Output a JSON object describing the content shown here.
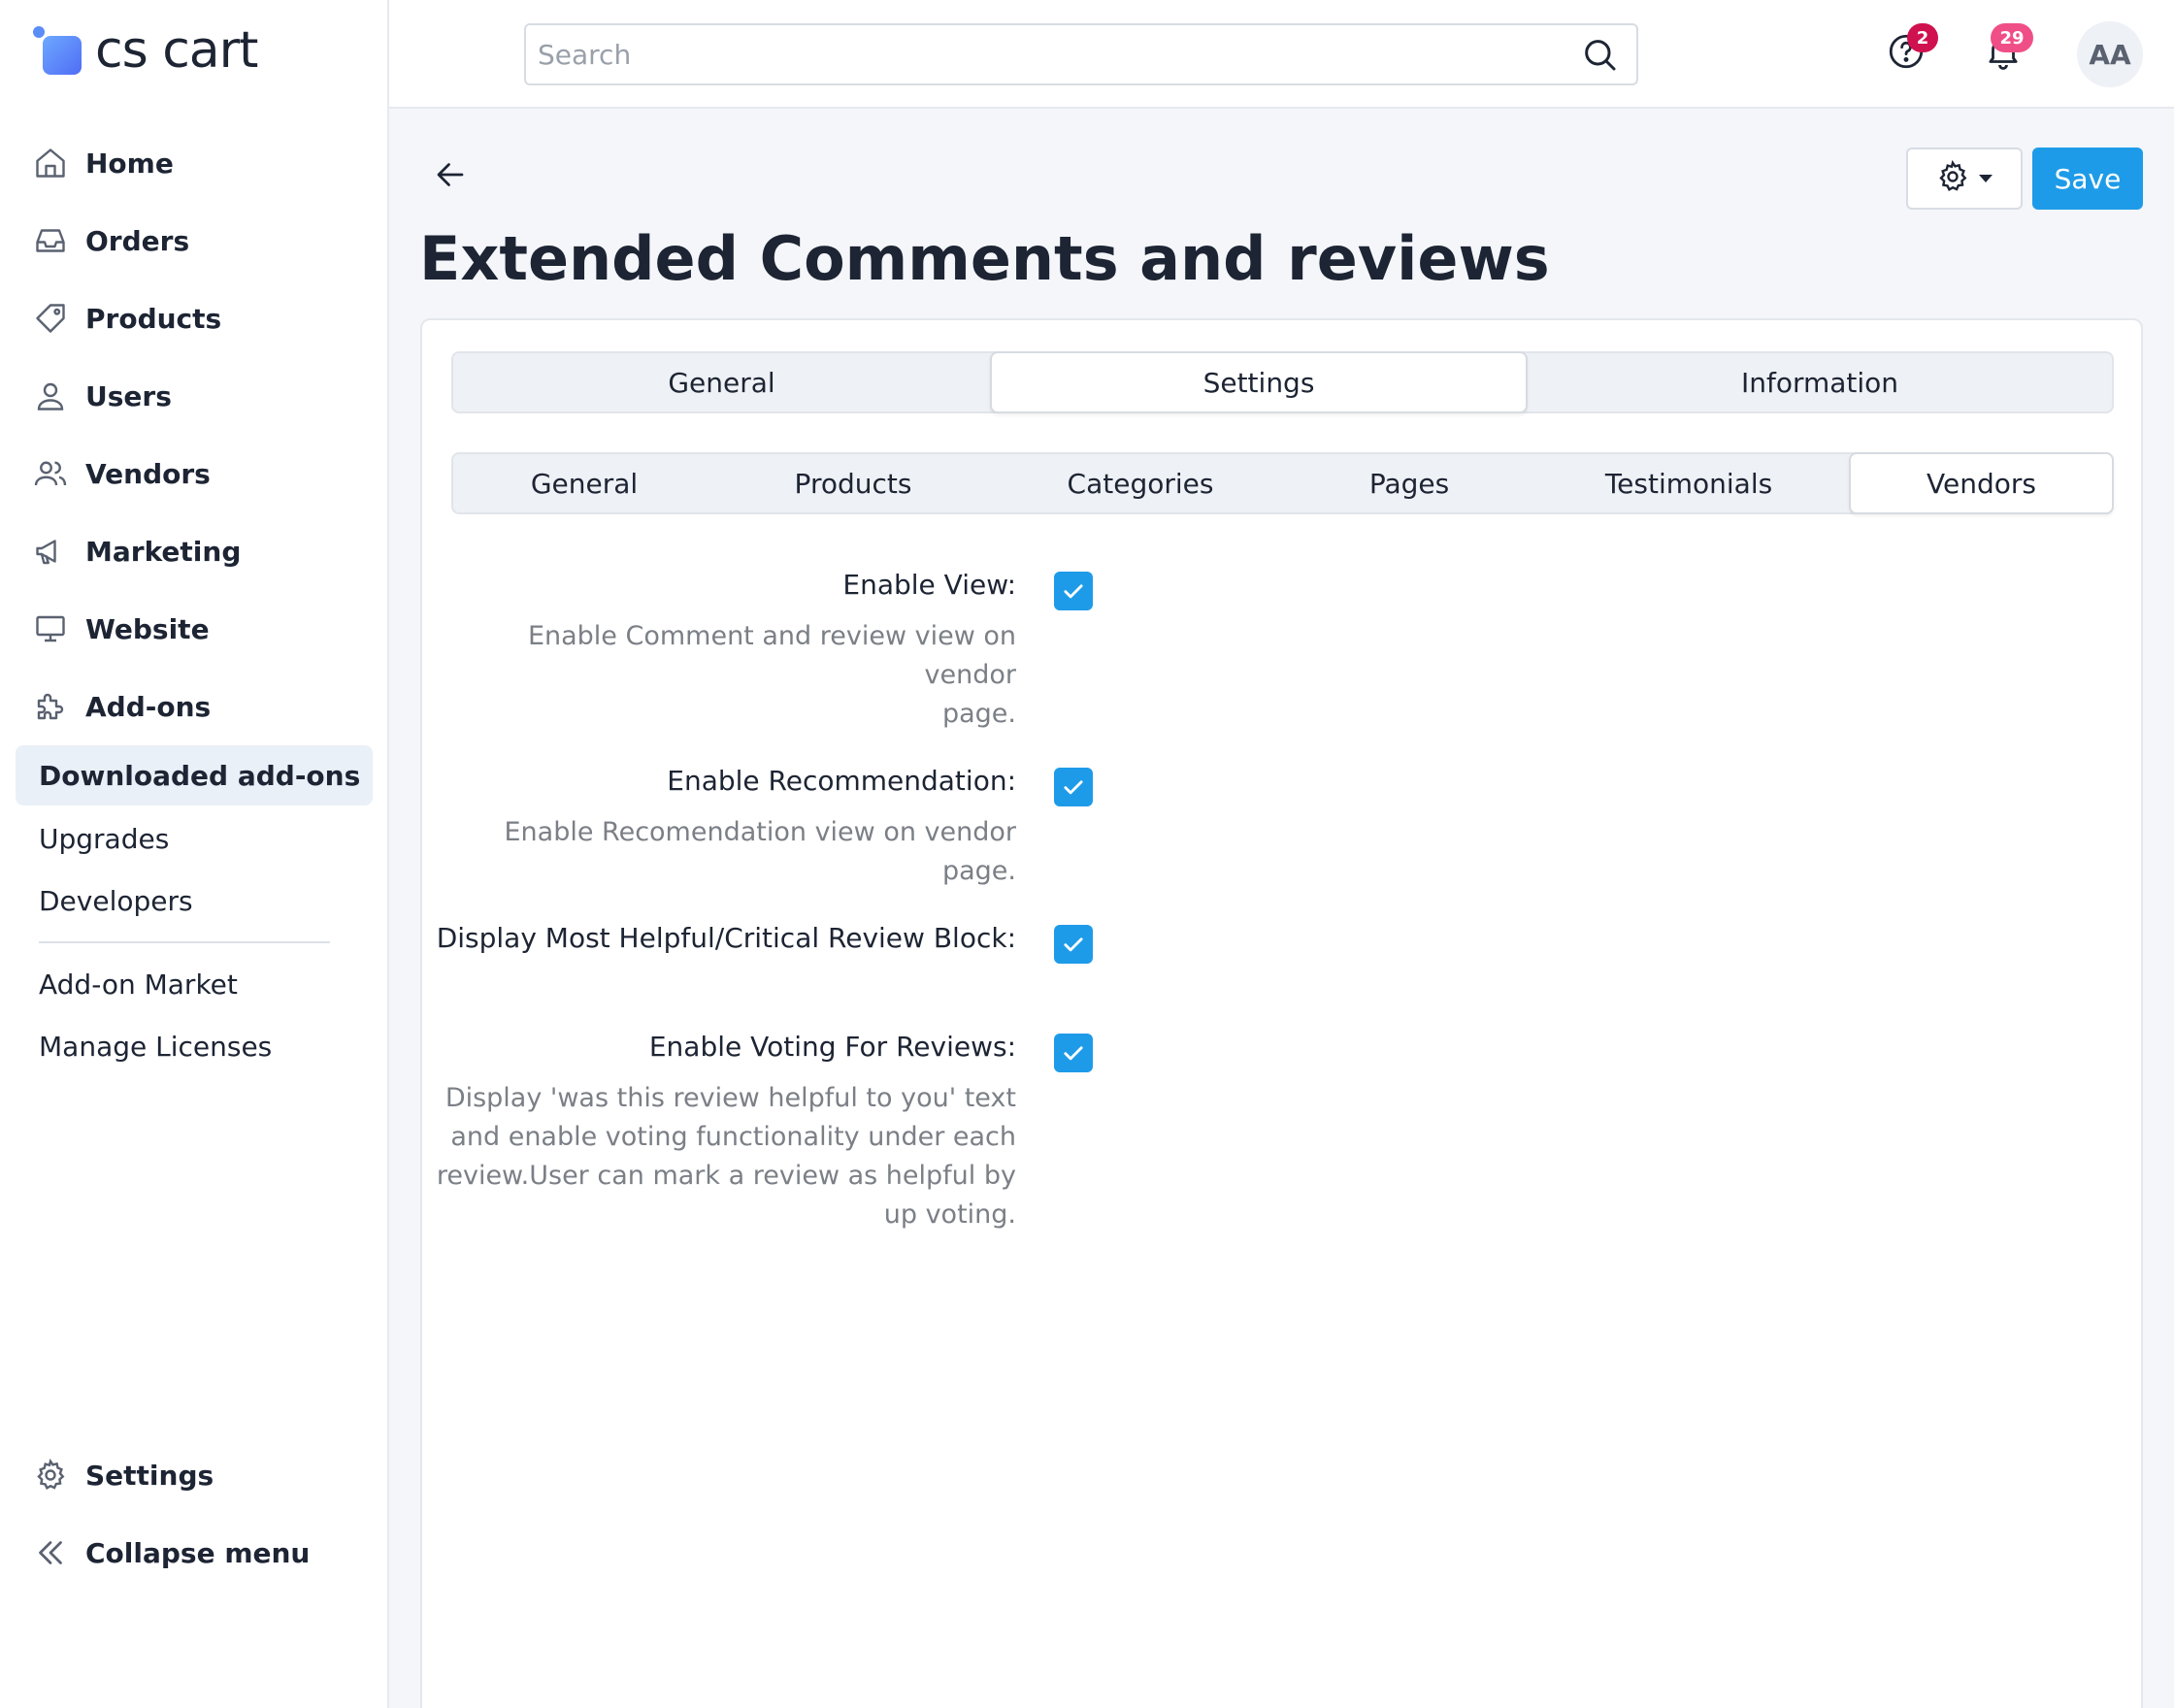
{
  "brand": {
    "logo_text": "cs cart"
  },
  "sidebar": {
    "main_items": [
      {
        "label": "Home",
        "icon": "home-icon"
      },
      {
        "label": "Orders",
        "icon": "inbox-icon"
      },
      {
        "label": "Products",
        "icon": "tag-icon"
      },
      {
        "label": "Users",
        "icon": "user-icon"
      },
      {
        "label": "Vendors",
        "icon": "users-icon"
      },
      {
        "label": "Marketing",
        "icon": "megaphone-icon"
      },
      {
        "label": "Website",
        "icon": "monitor-icon"
      },
      {
        "label": "Add-ons",
        "icon": "puzzle-icon"
      }
    ],
    "sub_items": [
      {
        "label": "Downloaded add-ons",
        "active": true
      },
      {
        "label": "Upgrades"
      },
      {
        "label": "Developers"
      },
      {
        "label": "Add-on Market"
      },
      {
        "label": "Manage Licenses"
      }
    ],
    "bottom_items": [
      {
        "label": "Settings",
        "icon": "gear-icon"
      },
      {
        "label": "Collapse menu",
        "icon": "double-chevron-left-icon"
      }
    ]
  },
  "topbar": {
    "search_placeholder": "Search",
    "help_badge": "2",
    "notifications_badge": "29",
    "avatar_initials": "AA"
  },
  "page": {
    "title": "Extended Comments and reviews",
    "save_label": "Save"
  },
  "tabs": [
    {
      "label": "General"
    },
    {
      "label": "Settings",
      "active": true
    },
    {
      "label": "Information"
    }
  ],
  "subtabs": [
    {
      "label": "General"
    },
    {
      "label": "Products"
    },
    {
      "label": "Categories"
    },
    {
      "label": "Pages"
    },
    {
      "label": "Testimonials"
    },
    {
      "label": "Vendors",
      "active": true
    }
  ],
  "fields": [
    {
      "label": "Enable View:",
      "desc_lines": [
        "Enable Comment and review view on vendor",
        "page."
      ],
      "checked": true
    },
    {
      "label": "Enable Recommendation:",
      "desc_lines": [
        "Enable Recomendation view on vendor page."
      ],
      "checked": true
    },
    {
      "label": "Display Most Helpful/Critical Review Block:",
      "desc_lines": [],
      "checked": true
    },
    {
      "label": "Enable Voting For Reviews:",
      "desc_lines": [
        "Display 'was this review helpful to you' text",
        "and enable voting functionality under each",
        "review.User can mark a review as helpful by",
        "up voting."
      ],
      "checked": true
    }
  ],
  "colors": {
    "accent": "#1e9be8",
    "help_badge": "#d0114f",
    "notifications_badge": "#ef4f86"
  }
}
